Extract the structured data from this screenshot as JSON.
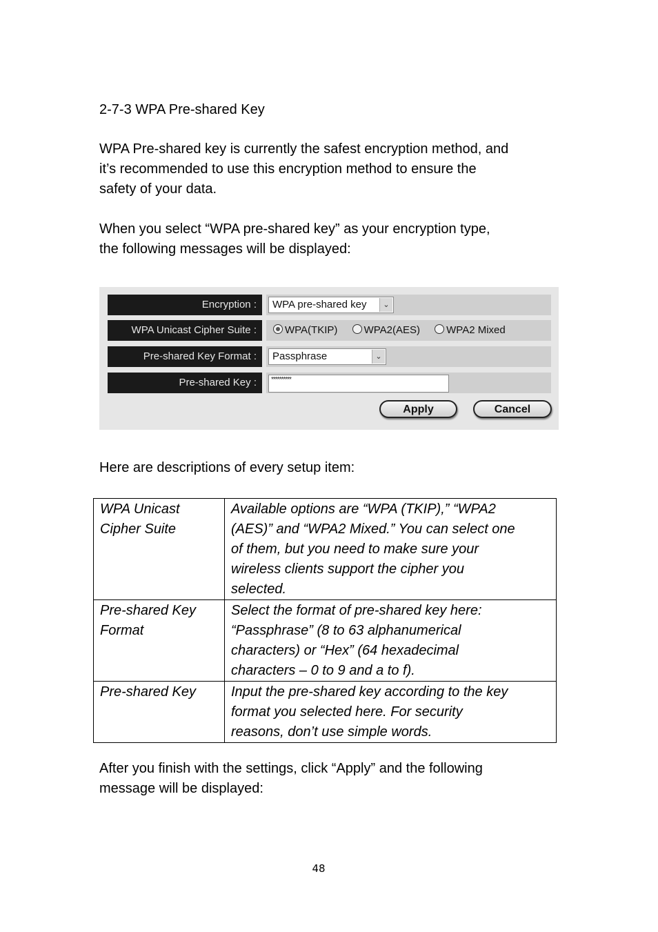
{
  "heading": "2-7-3 WPA Pre-shared Key",
  "para1": [
    "WPA Pre-shared key is currently the safest encryption method, and",
    "it’s recommended to use this encryption method to ensure the",
    "safety of your data."
  ],
  "para2": [
    "When you select “WPA pre-shared key” as your encryption type,",
    "the following messages will be displayed:"
  ],
  "ui": {
    "encryption": {
      "label": "Encryption :",
      "value": "WPA pre-shared key"
    },
    "cipher": {
      "label": "WPA Unicast Cipher Suite :",
      "options": [
        {
          "label": "WPA(TKIP)",
          "selected": true
        },
        {
          "label": "WPA2(AES)",
          "selected": false
        },
        {
          "label": "WPA2 Mixed",
          "selected": false
        }
      ]
    },
    "key_format": {
      "label": "Pre-shared Key Format :",
      "value": "Passphrase"
    },
    "key": {
      "label": "Pre-shared Key :",
      "value": "**********"
    },
    "apply_label": "Apply",
    "cancel_label": "Cancel",
    "dropdown_glyph": "⌄"
  },
  "para3": "Here are descriptions of every setup item:",
  "table": [
    {
      "item": [
        "WPA Unicast",
        "Cipher Suite"
      ],
      "desc": [
        "Available options are “WPA (TKIP),” “WPA2",
        "(AES)” and “WPA2 Mixed.” You can select one",
        "of them, but you need to make sure your",
        "wireless clients support the cipher you",
        "selected."
      ]
    },
    {
      "item": [
        "Pre-shared Key",
        "Format"
      ],
      "desc": [
        "Select the format of pre-shared key here:",
        "“Passphrase” (8 to 63 alphanumerical",
        "characters) or “Hex” (64 hexadecimal",
        "characters – 0 to 9 and a to f)."
      ]
    },
    {
      "item": [
        "Pre-shared Key"
      ],
      "desc": [
        "Input the pre-shared key according to the key",
        "format you selected here. For security",
        "reasons, don’t use simple words."
      ]
    }
  ],
  "para4": [
    "After you finish with the settings, click “Apply” and the following",
    "message will be displayed:"
  ],
  "page_number": "48"
}
